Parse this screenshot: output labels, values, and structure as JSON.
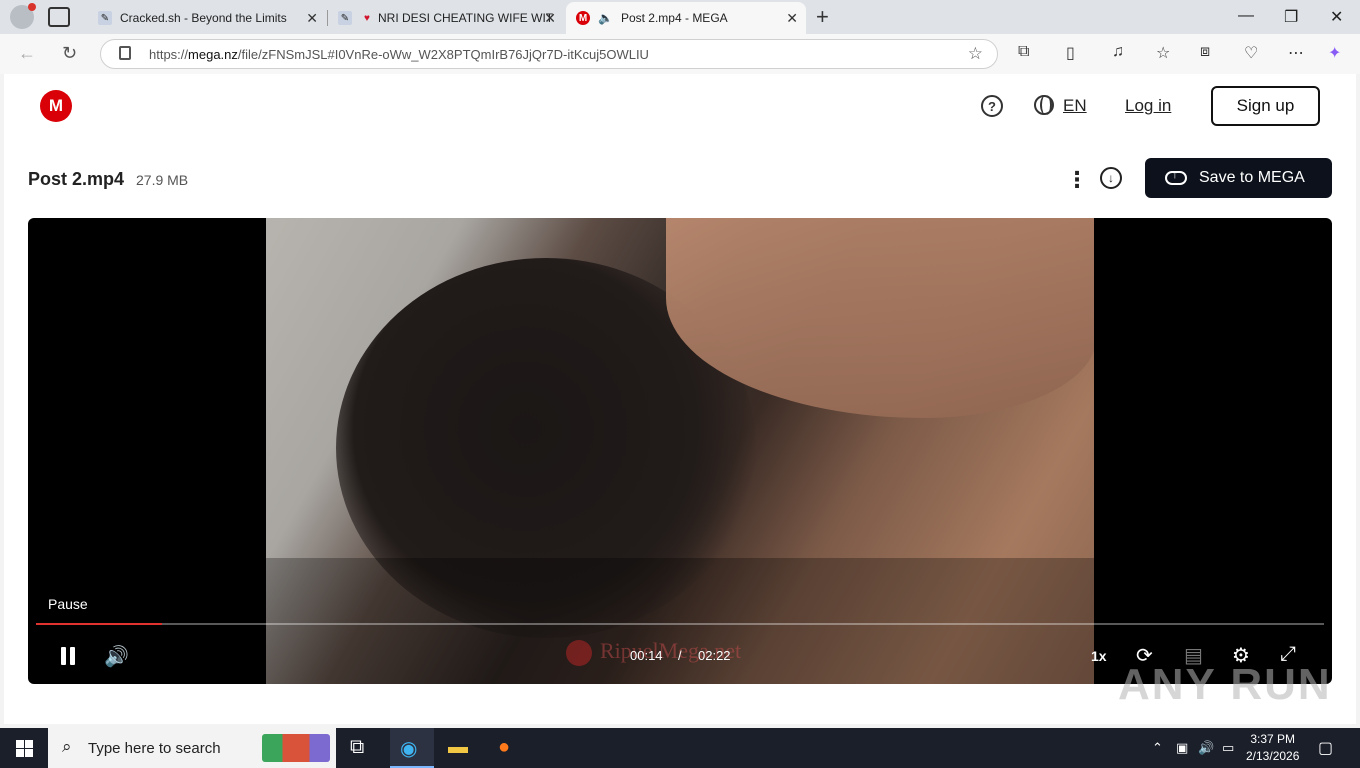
{
  "browser": {
    "tabs": [
      {
        "title": "Cracked.sh - Beyond the Limits"
      },
      {
        "title": "NRI DESI CHEATING WIFE WIT"
      },
      {
        "title": "Post 2.mp4 - MEGA"
      }
    ],
    "url_prefix": "https://",
    "url_host": "mega.nz",
    "url_path": "/file/zFNSmJSL#I0VnRe-oWw_W2X8PTQmIrB76JjQr7D-itKcuj5OWLIU"
  },
  "header": {
    "logo": "M",
    "help": "?",
    "language": "EN",
    "login_label": "Log in",
    "signup_label": "Sign up"
  },
  "file": {
    "name": "Post 2.mp4",
    "size": "27.9 MB",
    "save_label": "Save to MEGA"
  },
  "player": {
    "tooltip": "Pause",
    "current_time": "00:14",
    "separator": "/",
    "duration": "02:22",
    "speed": "1x",
    "progress_fraction": 0.098,
    "watermark": "RipuelMega.net"
  },
  "watermark_overlay": "ANY RUN",
  "taskbar": {
    "search_placeholder": "Type here to search",
    "time": "3:37 PM",
    "date": "2/13/2026"
  }
}
